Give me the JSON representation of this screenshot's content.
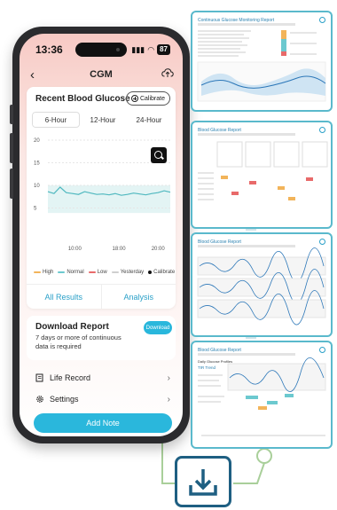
{
  "status": {
    "time": "13:36",
    "battery": "87"
  },
  "nav": {
    "title": "CGM",
    "back_icon": "chevron-left-icon",
    "upload_icon": "cloud-upload-icon"
  },
  "glucose": {
    "title": "Recent Blood Glucose",
    "calibrate_label": "Calibrate",
    "tabs": [
      "6-Hour",
      "12-Hour",
      "24-Hour"
    ],
    "active_tab": "6-Hour"
  },
  "legend": [
    {
      "label": "High",
      "color": "#f2b45a"
    },
    {
      "label": "Normal",
      "color": "#6cc9cf"
    },
    {
      "label": "Low",
      "color": "#e86a6a"
    },
    {
      "label": "Yesterday",
      "color": "#cfcfcf"
    },
    {
      "label": "Calibrate",
      "color": "#111111"
    }
  ],
  "results": {
    "all_results": "All Results",
    "analysis": "Analysis"
  },
  "download": {
    "title": "Download Report",
    "desc": "7 days or more of continuous data is required",
    "button": "Download"
  },
  "menu": [
    {
      "label": "Life Record",
      "icon": "notebook-icon"
    },
    {
      "label": "Settings",
      "icon": "gear-icon"
    }
  ],
  "add_note": "Add Note",
  "chart_data": {
    "type": "line",
    "y_ticks": [
      20,
      15,
      10,
      5
    ],
    "x_ticks": [
      "10:00",
      "18:00",
      "20:00"
    ],
    "ylim": [
      0,
      20
    ],
    "target_range": [
      3.9,
      10
    ],
    "x": [
      0,
      0.3,
      0.6,
      0.9,
      1.2,
      1.5,
      1.8,
      2.1,
      2.4,
      2.7,
      3.0,
      3.3,
      3.6,
      3.9,
      4.2,
      4.5,
      4.8,
      5.1,
      5.4,
      5.7,
      6.0
    ],
    "series": [
      {
        "values": [
          8.6,
          8.2,
          9.6,
          8.4,
          8.2,
          8.0,
          8.6,
          8.3,
          8.0,
          8.1,
          7.9,
          8.2,
          7.8,
          8.0,
          8.3,
          8.1,
          7.9,
          8.2,
          8.4,
          8.8,
          8.5
        ]
      }
    ]
  },
  "reports": [
    {
      "title": "Continuous Glucose Monitoring Report"
    },
    {
      "title": "Blood Glucose Report"
    },
    {
      "title": "Blood Glucose Report"
    },
    {
      "title": "Blood Glucose Report",
      "subtitle": "Daily Glucose Profiles",
      "section": "TIR Trend"
    }
  ]
}
